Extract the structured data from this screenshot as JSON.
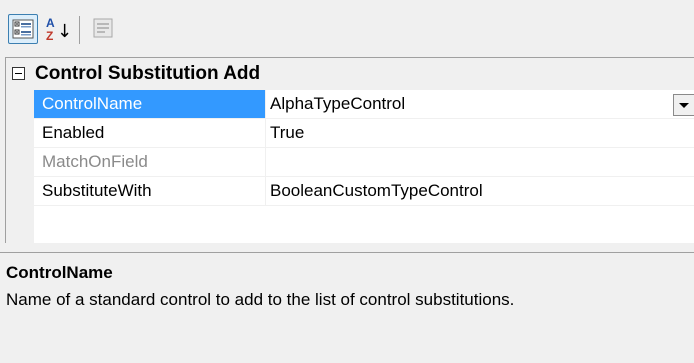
{
  "toolbar": {
    "categorized_icon": "categorized-icon",
    "alphabetical_icon": "sort-alphabetical-icon",
    "property_pages_icon": "property-pages-icon",
    "az_glyph_a": "A",
    "az_glyph_z": "Z",
    "az_glyph_arrow": "↓"
  },
  "grid": {
    "category": "Control Substitution Add",
    "rows": [
      {
        "name": "ControlName",
        "value": "AlphaTypeControl"
      },
      {
        "name": "Enabled",
        "value": "True"
      },
      {
        "name": "MatchOnField",
        "value": ""
      },
      {
        "name": "SubstituteWith",
        "value": "BooleanCustomTypeControl"
      }
    ]
  },
  "description": {
    "title": "ControlName",
    "text": "Name of a standard control to add to the list of control substitutions."
  },
  "colors": {
    "selection": "#3399ff",
    "panel": "#f0f0f0",
    "disabled_text": "#8a8a8a"
  }
}
